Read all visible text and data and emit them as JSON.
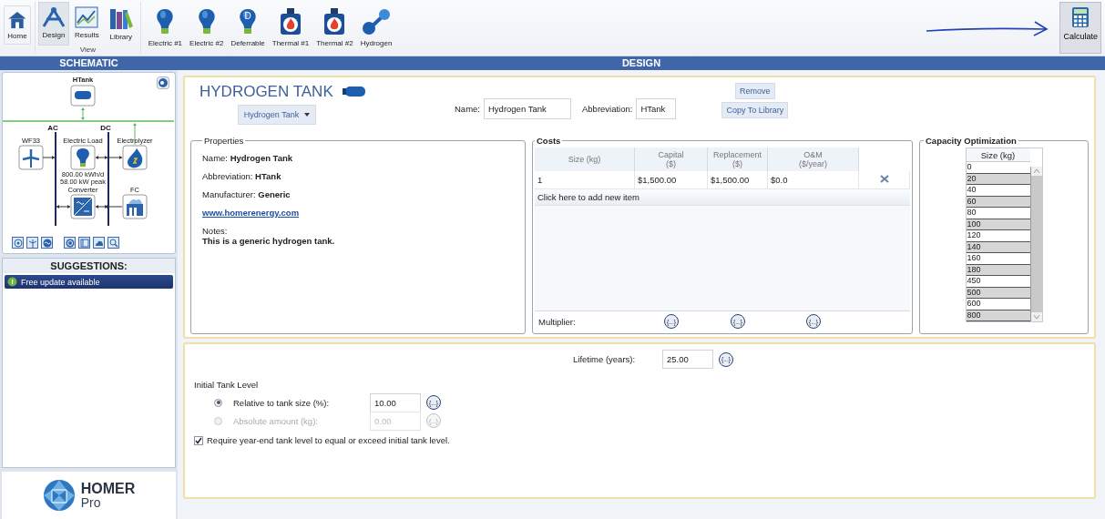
{
  "ribbon": {
    "home": {
      "label": "Home"
    },
    "view": {
      "label": "View",
      "tabs": [
        {
          "label": "Design",
          "kind": "design",
          "selected": true
        },
        {
          "label": "Results",
          "kind": "results",
          "selected": false
        },
        {
          "label": "Library",
          "kind": "library",
          "selected": false
        }
      ]
    },
    "loads": [
      {
        "label": "Electric #1",
        "kind": "electric"
      },
      {
        "label": "Electric #2",
        "kind": "electric"
      },
      {
        "label": "Deferrable",
        "kind": "deferrable",
        "badge": "D"
      },
      {
        "label": "Thermal #1",
        "kind": "thermal"
      },
      {
        "label": "Thermal #2",
        "kind": "thermal"
      },
      {
        "label": "Hydrogen",
        "kind": "hydrogen"
      }
    ],
    "calculate": {
      "label": "Calculate"
    }
  },
  "schematic": {
    "title": "SCHEMATIC",
    "storage": {
      "label": "HTank"
    },
    "buses": [
      {
        "label": "AC"
      },
      {
        "label": "DC"
      }
    ],
    "components": [
      {
        "label": "WF33",
        "kind": "wind"
      },
      {
        "label": "Electric Load",
        "kind": "load",
        "notes": [
          "800.00 kWh/d",
          "58.00 kW peak"
        ]
      },
      {
        "label": "Electrolyzer",
        "kind": "electrolyzer"
      },
      {
        "label": "Converter",
        "kind": "converter"
      },
      {
        "label": "FC",
        "kind": "fuel_cell"
      }
    ]
  },
  "suggestions": {
    "title": "SUGGESTIONS:",
    "items": [
      {
        "label": "Free update available"
      }
    ]
  },
  "logo": {
    "name": "HOMER",
    "edition": "Pro"
  },
  "design": {
    "title": "DESIGN",
    "component_title": "HYDROGEN TANK",
    "type_dropdown": "Hydrogen Tank",
    "name_field": {
      "label": "Name:",
      "value": "Hydrogen Tank"
    },
    "abbreviation_field": {
      "label": "Abbreviation:",
      "value": "HTank"
    },
    "buttons": [
      "Remove",
      "Copy To Library"
    ],
    "properties": {
      "legend": "Properties",
      "lines": [
        "Name: **Hydrogen Tank**",
        "Abbreviation: **HTank**",
        "Manufacturer: **Generic**"
      ],
      "link": "www.homerenergy.com",
      "notes_label": "Notes:",
      "notes": "This is a generic hydrogen tank."
    },
    "costs": {
      "legend": "Costs",
      "columns": [
        {
          "label": "Size (kg)"
        },
        {
          "label": "Capital",
          "unit": "($)"
        },
        {
          "label": "Replacement",
          "unit": "($)"
        },
        {
          "label": "O&M",
          "unit": "($/year)"
        }
      ],
      "rows": [
        {
          "cells": [
            "1",
            "$1,500.00",
            "$1,500.00",
            "$0.0"
          ]
        }
      ],
      "add_item": "Click here to add new item",
      "multiplier": {
        "label": "Multiplier:",
        "buttons": [
          "{...}",
          "{...}",
          "{...}"
        ]
      }
    },
    "capacity_optimization": {
      "legend": "Capacity Optimization",
      "column": "Size (kg)",
      "values": [
        "0",
        "20",
        "40",
        "60",
        "80",
        "100",
        "120",
        "140",
        "160",
        "180",
        "450",
        "500",
        "600",
        "800"
      ]
    },
    "lifetime": {
      "label": "Lifetime (years):",
      "value": "25.00",
      "button": "{...}"
    },
    "initial_tank_level": {
      "title": "Initial Tank Level",
      "options": [
        {
          "label": "Relative to tank size (%):",
          "value": "10.00",
          "button": "{...}",
          "selected": true,
          "disabled": false
        },
        {
          "label": "Absolute amount (kg):",
          "value": "0.00",
          "button": "{...}",
          "selected": false,
          "disabled": true
        }
      ]
    },
    "require_year_end": {
      "label": "Require year-end tank level to equal or exceed initial tank level.",
      "checked": true
    }
  }
}
